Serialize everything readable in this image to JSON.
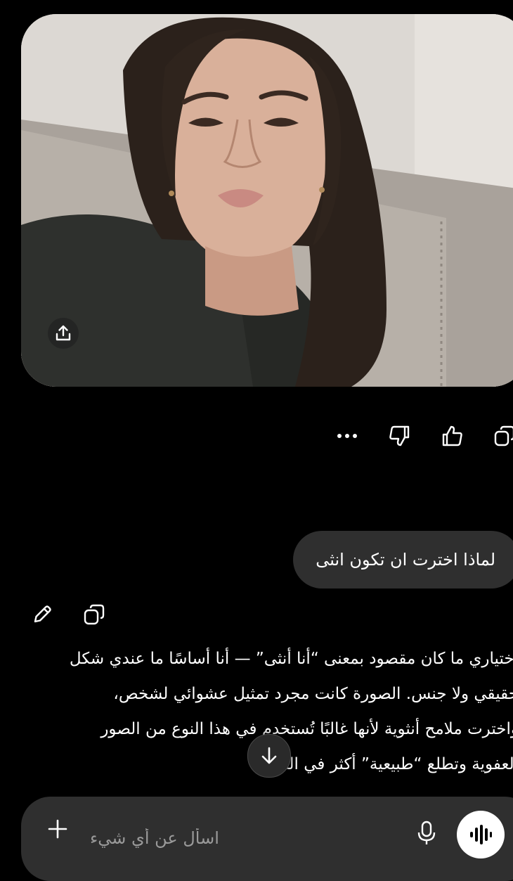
{
  "image_card": {
    "share_icon": "share-upload-icon"
  },
  "response_actions": {
    "copy_icon": "copy-icon",
    "like_icon": "thumbs-up-icon",
    "dislike_icon": "thumbs-down-icon",
    "more_icon": "more-dots-icon"
  },
  "user_message": {
    "text": "لماذا اخترت ان تكون انثى"
  },
  "answer": {
    "edit_icon": "pencil-icon",
    "copy_icon": "copy-icon",
    "text": "اختياري ما كان مقصود بمعنى “أنا أنثى” — أنا أساسًا ما عندي شكل\nحقيقي ولا جنس. الصورة كانت مجرد تمثيل عشوائي لشخص،\nواخترت ملامح أنثوية لأنها غالبًا تُستخدم في هذا النوع من الصور\nالعفوية وتطلع “طبيعية” أكثر في النتيجة."
  },
  "scroll_down": {
    "icon": "arrow-down-icon"
  },
  "composer": {
    "placeholder": "اسأل عن أي شيء",
    "add_icon": "plus-icon",
    "mic_icon": "microphone-icon",
    "voice_icon": "voice-waveform-icon"
  },
  "colors": {
    "background": "#000000",
    "bubble": "#2f2f2f",
    "text": "#ffffff",
    "placeholder": "#9a9a9a"
  }
}
